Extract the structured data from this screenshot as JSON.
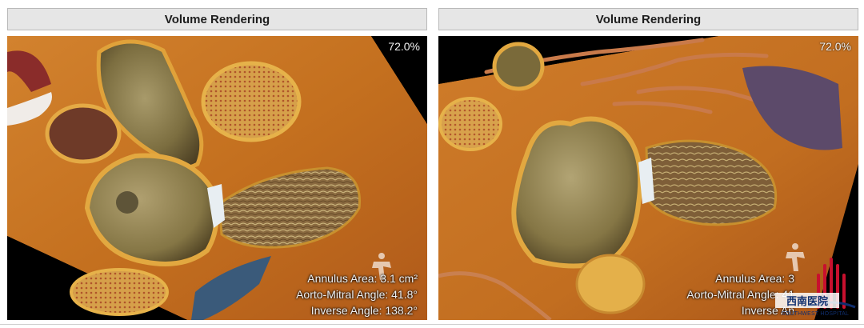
{
  "panels": [
    {
      "header": "Volume Rendering",
      "zoom": "72.0%",
      "measurements": {
        "annulus_area": "Annulus Area: 3.1 cm²",
        "aorto_mitral_angle": "Aorto-Mitral Angle: 41.8°",
        "inverse_angle": "Inverse Angle: 138.2°"
      }
    },
    {
      "header": "Volume Rendering",
      "zoom": "72.0%",
      "measurements": {
        "annulus_area": "Annulus Area: 3",
        "aorto_mitral_angle": "Aorto-Mitral Angle: 41",
        "inverse_angle": "Inverse An"
      }
    }
  ],
  "watermark": {
    "name": "西南医院",
    "subtitle": "SOUTHWEST HOSPITAL"
  },
  "colors": {
    "header_bg": "#e6e6e6",
    "tissue_orange": "#c8782a",
    "tissue_yellow": "#e8b040",
    "chamber_olive": "#8a7a45",
    "logo_red": "#c8102e",
    "logo_blue": "#0f2e6e"
  }
}
